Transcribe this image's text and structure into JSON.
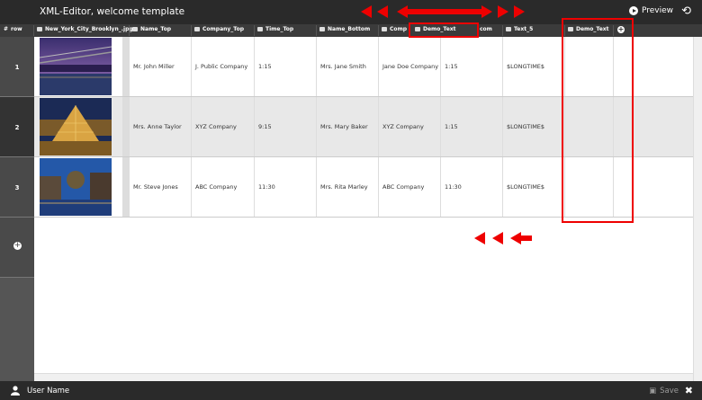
{
  "app": {
    "title": "XML-Editor, welcome template",
    "preview_label": "Preview"
  },
  "columns": {
    "row": "row",
    "image": "New_York_City_Brooklyn_.jpg",
    "name_top": "Name_Top",
    "company_top": "Company_Top",
    "time_top": "Time_Top",
    "name_bottom": "Name_Bottom",
    "comp_partial": "Comp",
    "demo_text_dragged": "Demo_Text",
    "partial_com": "com",
    "text_5": "Text_5",
    "demo_text": "Demo_Text"
  },
  "rows": [
    {
      "num": "1",
      "name_top": "Mr. John Miller",
      "company_top": "J. Public Company",
      "time_top": "1:15",
      "name_bottom": "Mrs. Jane Smith",
      "company_bottom": "Jane Doe Company",
      "time_bottom": "1:15",
      "text_5": "$LONGTIME$"
    },
    {
      "num": "2",
      "name_top": "Mrs. Anne Taylor",
      "company_top": "XYZ Company",
      "time_top": "9:15",
      "name_bottom": "Mrs. Mary Baker",
      "company_bottom": "XYZ Company",
      "time_bottom": "1:15",
      "text_5": "$LONGTIME$"
    },
    {
      "num": "3",
      "name_top": "Mr. Steve Jones",
      "company_top": "ABC Company",
      "time_top": "11:30",
      "name_bottom": "Mrs. Rita Marley",
      "company_bottom": "ABC Company",
      "time_bottom": "11:30",
      "text_5": "$LONGTIME$"
    }
  ],
  "footer": {
    "user": "User Name",
    "save_label": "Save"
  },
  "colors": {
    "annotation": "#e00000",
    "bar": "#2a2a2a",
    "header": "#3b3b3b"
  }
}
